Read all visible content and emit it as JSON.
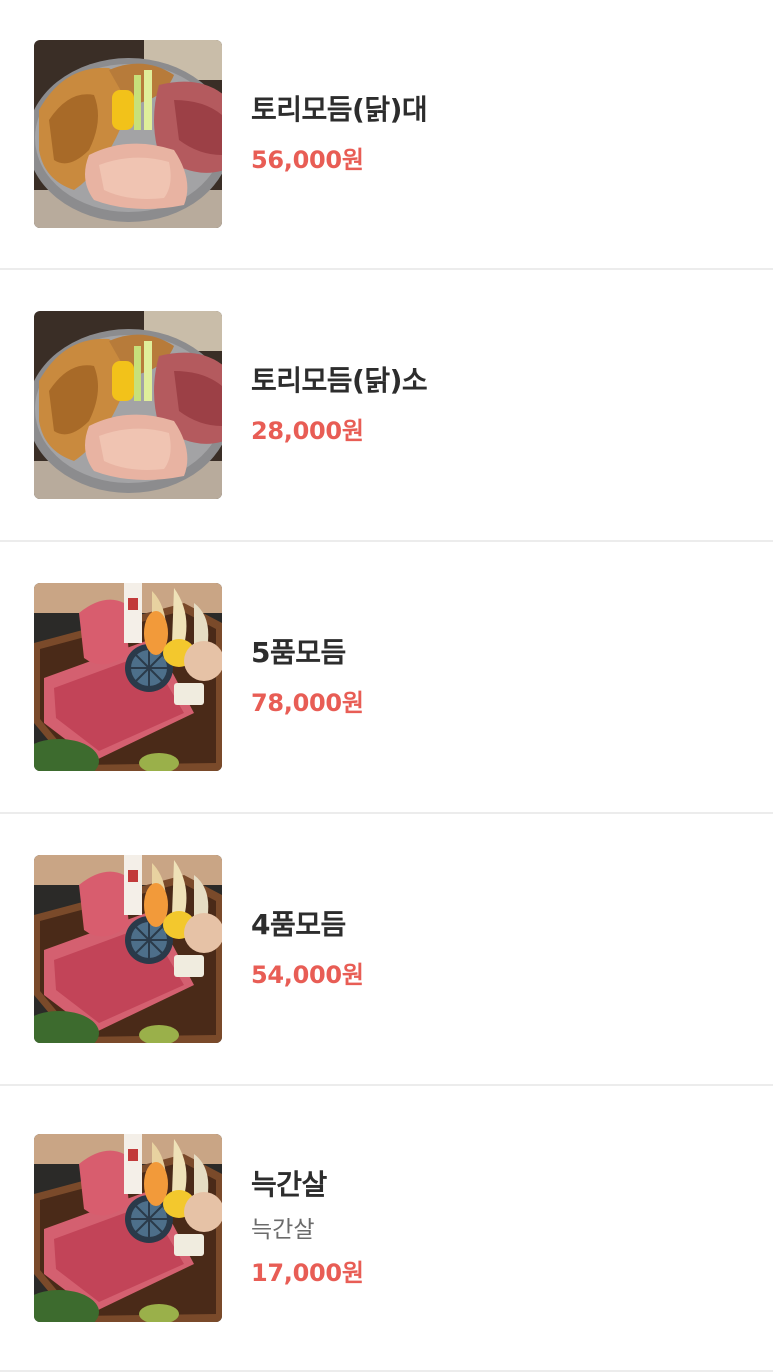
{
  "menu": {
    "items": [
      {
        "name": "토리모듬(닭)대",
        "price": "56,000원",
        "image": "chicken-platter"
      },
      {
        "name": "토리모듬(닭)소",
        "price": "28,000원",
        "image": "chicken-platter"
      },
      {
        "name": "5품모듬",
        "price": "78,000원",
        "image": "beef-platter"
      },
      {
        "name": "4품모듬",
        "price": "54,000원",
        "image": "beef-platter"
      },
      {
        "name": "늑간살",
        "description": "늑간살",
        "price": "17,000원",
        "image": "beef-platter"
      }
    ]
  },
  "colors": {
    "price": "#e85d55",
    "name": "#2d2d2d",
    "description": "#6b6b6b",
    "divider": "#ececec"
  }
}
